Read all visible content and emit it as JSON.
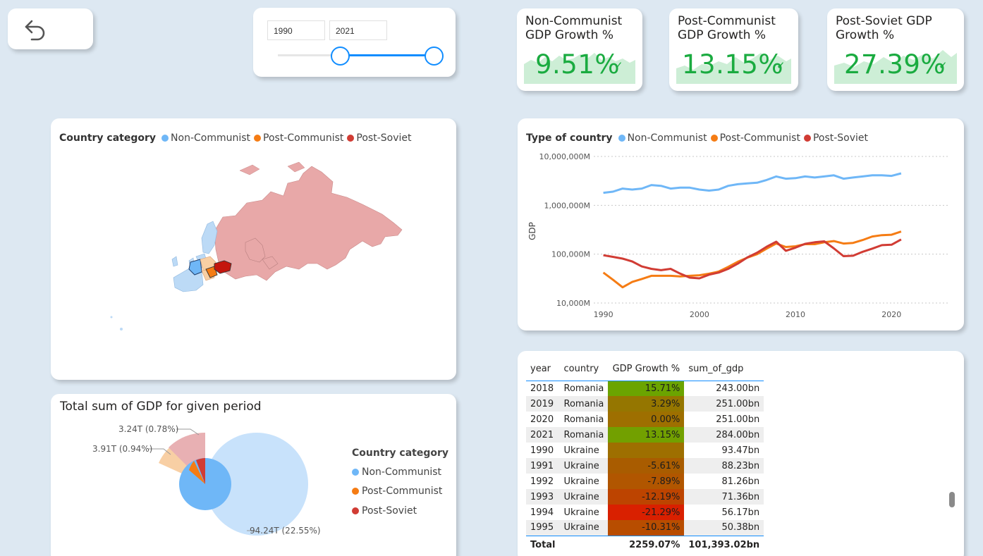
{
  "slicer": {
    "start_year": "1990",
    "end_year": "2021"
  },
  "kpis": [
    {
      "title_line1": "Non-Communist",
      "title_line2": "GDP Growth %",
      "value": "9.51%"
    },
    {
      "title_line1": "Post-Communist",
      "title_line2": "GDP Growth %",
      "value": "13.15%"
    },
    {
      "title_line1": "Post-Soviet GDP",
      "title_line2": "Growth %",
      "value": "27.39%"
    }
  ],
  "map": {
    "legend_title": "Country category",
    "legend_items": [
      {
        "label": "Non-Communist",
        "color": "#6fb7f7"
      },
      {
        "label": "Post-Communist",
        "color": "#f57c14"
      },
      {
        "label": "Post-Soviet",
        "color": "#d13c34"
      }
    ]
  },
  "line_chart": {
    "legend_title": "Type of country",
    "legend_items": [
      {
        "label": "Non-Communist",
        "color": "#6fb7f7"
      },
      {
        "label": "Post-Communist",
        "color": "#f57c14"
      },
      {
        "label": "Post-Soviet",
        "color": "#d13c34"
      }
    ],
    "ylabel": "GDP",
    "y_ticks": [
      "10,000,000M",
      "1,000,000M",
      "100,000M",
      "10,000M"
    ],
    "x_ticks": [
      "1990",
      "2000",
      "2010",
      "2020"
    ]
  },
  "donut": {
    "title": "Total sum of GDP for given period",
    "legend_title": "Country category",
    "legend_items": [
      {
        "label": "Non-Communist",
        "color": "#6fb7f7"
      },
      {
        "label": "Post-Communist",
        "color": "#f57c14"
      },
      {
        "label": "Post-Soviet",
        "color": "#d13c34"
      }
    ],
    "labels": [
      "3.24T (0.78%)",
      "3.91T (0.94%)",
      "94.24T (22.55%)"
    ]
  },
  "table": {
    "headers": [
      "year",
      "country",
      "GDP Growth %",
      "sum_of_gdp"
    ],
    "rows": [
      {
        "year": "2018",
        "country": "Romania",
        "growth": "15.71%",
        "gdp": "243.00bn",
        "color": "#6ba400"
      },
      {
        "year": "2019",
        "country": "Romania",
        "growth": "3.29%",
        "gdp": "251.00bn",
        "color": "#957600"
      },
      {
        "year": "2020",
        "country": "Romania",
        "growth": "0.00%",
        "gdp": "251.00bn",
        "color": "#9e6f00"
      },
      {
        "year": "2021",
        "country": "Romania",
        "growth": "13.15%",
        "gdp": "284.00bn",
        "color": "#72a000"
      },
      {
        "year": "1990",
        "country": "Ukraine",
        "growth": "",
        "gdp": "93.47bn",
        "color": "#9e6f00"
      },
      {
        "year": "1991",
        "country": "Ukraine",
        "growth": "-5.61%",
        "gdp": "88.23bn",
        "color": "#a95c00"
      },
      {
        "year": "1992",
        "country": "Ukraine",
        "growth": "-7.89%",
        "gdp": "81.26bn",
        "color": "#b15600"
      },
      {
        "year": "1993",
        "country": "Ukraine",
        "growth": "-12.19%",
        "gdp": "71.36bn",
        "color": "#bd4400"
      },
      {
        "year": "1994",
        "country": "Ukraine",
        "growth": "-21.29%",
        "gdp": "56.17bn",
        "color": "#d92000"
      },
      {
        "year": "1995",
        "country": "Ukraine",
        "growth": "-10.31%",
        "gdp": "50.38bn",
        "color": "#b84d00"
      }
    ],
    "total_label": "Total",
    "total_growth": "2259.07%",
    "total_gdp": "101,393.02bn"
  },
  "chart_data": [
    {
      "type": "line",
      "title": "",
      "xlabel": "",
      "ylabel": "GDP",
      "yscale": "log",
      "ylim": [
        10000,
        10000000
      ],
      "xlim": [
        1989,
        2026
      ],
      "x": [
        1990,
        1991,
        1992,
        1993,
        1994,
        1995,
        1996,
        1997,
        1998,
        1999,
        2000,
        2001,
        2002,
        2003,
        2004,
        2005,
        2006,
        2007,
        2008,
        2009,
        2010,
        2011,
        2012,
        2013,
        2014,
        2015,
        2016,
        2017,
        2018,
        2019,
        2020,
        2021
      ],
      "series": [
        {
          "name": "Non-Communist",
          "color": "#6fb7f7",
          "values": [
            1800000,
            1900000,
            2200000,
            2100000,
            2200000,
            2600000,
            2500000,
            2200000,
            2300000,
            2300000,
            2100000,
            2000000,
            2100000,
            2500000,
            2700000,
            2800000,
            2900000,
            3300000,
            3900000,
            3500000,
            3600000,
            3900000,
            3700000,
            3900000,
            4100000,
            3500000,
            3700000,
            3900000,
            4100000,
            4100000,
            4000000,
            4500000
          ]
        },
        {
          "name": "Post-Communist",
          "color": "#f57c14",
          "values": [
            42000,
            30000,
            21000,
            27000,
            31000,
            36000,
            36000,
            36000,
            35000,
            36000,
            37000,
            40000,
            44000,
            55000,
            70000,
            85000,
            100000,
            130000,
            165000,
            140000,
            145000,
            160000,
            160000,
            175000,
            185000,
            165000,
            170000,
            195000,
            230000,
            245000,
            250000,
            290000
          ]
        },
        {
          "name": "Post-Soviet",
          "color": "#d13c34",
          "values": [
            95000,
            88000,
            81000,
            71000,
            56000,
            50000,
            47000,
            50000,
            40000,
            33000,
            32000,
            38000,
            42000,
            50000,
            64000,
            86000,
            107000,
            142000,
            180000,
            117000,
            136000,
            163000,
            175000,
            183000,
            131000,
            91000,
            93000,
            112000,
            130000,
            153000,
            156000,
            200000
          ]
        }
      ]
    },
    {
      "type": "pie",
      "title": "Total sum of GDP for given period",
      "categories": [
        "Non-Communist",
        "Post-Communist",
        "Post-Soviet"
      ],
      "inner_values": [
        94.24,
        3.91,
        3.24
      ],
      "outer_labels": [
        "3.24T (0.78%)",
        "3.91T (0.94%)",
        "94.24T (22.55%)"
      ]
    }
  ]
}
